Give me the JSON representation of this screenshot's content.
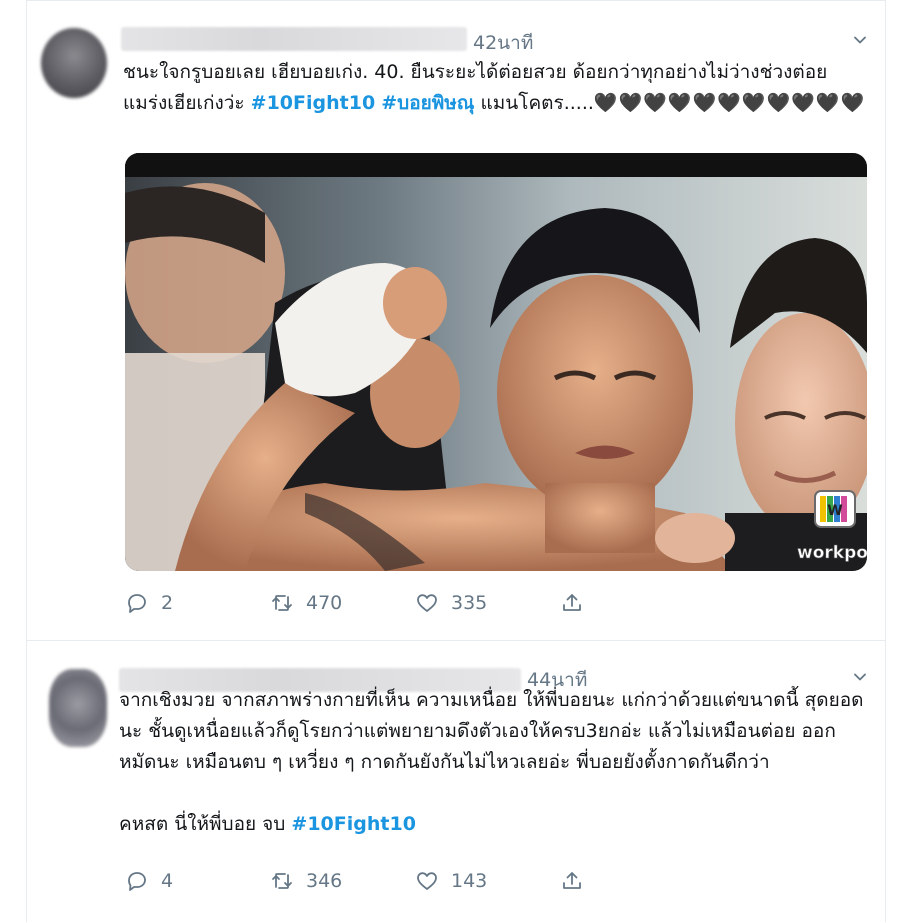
{
  "tweets": [
    {
      "time": "42นาที",
      "text_plain": "ชนะใจกรูบอยเลย เฮียบอยเก่ง. 40. ยืนระยะได้ต่อยสวย ด้อยกว่าทุกอย่างไม่ว่างช่วงต่อย แมร่งเฮียเก่งว่ะ ",
      "hashtag_1": "#10Fight10",
      "hashtag_2": "#บอยพิษณุ",
      "text_after": " แมนโคตร.....",
      "hearts": "🖤🖤🖤🖤🖤🖤🖤🖤🖤🖤🖤",
      "media_logo": "workpo",
      "media_badge": "W",
      "replies": "2",
      "retweets": "470",
      "likes": "335"
    },
    {
      "time": "44นาที",
      "text_plain": "จากเชิงมวย จากสภาพร่างกายที่เห็น ความเหนื่อย ให้พี่บอยนะ แก่กว่าด้วยแต่ขนาดนี้ สุดยอดนะ ชั้นดูเหนื่อยแล้วก็ดูโรยกว่าแต่พยายามดึงตัวเองให้ครบ3ยกอ่ะ แล้วไม่เหมือนต่อย ออกหมัดนะ เหมือนตบ ๆ เหวี่ยง ๆ กาดกันยังกันไม่ไหวเลยอ่ะ พี่บอยยังตั้งกาดกันดีกว่า\n\nคหสต นี่ให้พี่บอย จบ ",
      "hashtag_1": "#10Fight10",
      "replies": "4",
      "retweets": "346",
      "likes": "143"
    }
  ],
  "colors": {
    "link": "#1b95e0",
    "muted": "#657786",
    "border": "#e6ecf0"
  },
  "icons": [
    "chevron-down-icon",
    "reply-icon",
    "retweet-icon",
    "like-icon",
    "share-icon"
  ]
}
